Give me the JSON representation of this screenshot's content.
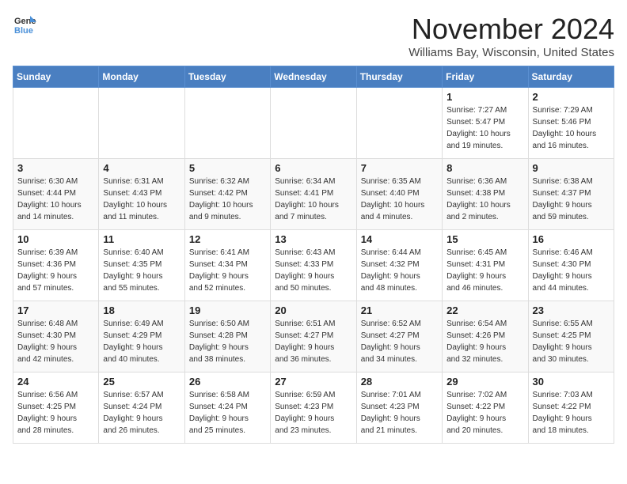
{
  "logo": {
    "line1": "General",
    "line2": "Blue"
  },
  "title": "November 2024",
  "location": "Williams Bay, Wisconsin, United States",
  "days_of_week": [
    "Sunday",
    "Monday",
    "Tuesday",
    "Wednesday",
    "Thursday",
    "Friday",
    "Saturday"
  ],
  "weeks": [
    [
      {
        "day": "",
        "info": ""
      },
      {
        "day": "",
        "info": ""
      },
      {
        "day": "",
        "info": ""
      },
      {
        "day": "",
        "info": ""
      },
      {
        "day": "",
        "info": ""
      },
      {
        "day": "1",
        "info": "Sunrise: 7:27 AM\nSunset: 5:47 PM\nDaylight: 10 hours\nand 19 minutes."
      },
      {
        "day": "2",
        "info": "Sunrise: 7:29 AM\nSunset: 5:46 PM\nDaylight: 10 hours\nand 16 minutes."
      }
    ],
    [
      {
        "day": "3",
        "info": "Sunrise: 6:30 AM\nSunset: 4:44 PM\nDaylight: 10 hours\nand 14 minutes."
      },
      {
        "day": "4",
        "info": "Sunrise: 6:31 AM\nSunset: 4:43 PM\nDaylight: 10 hours\nand 11 minutes."
      },
      {
        "day": "5",
        "info": "Sunrise: 6:32 AM\nSunset: 4:42 PM\nDaylight: 10 hours\nand 9 minutes."
      },
      {
        "day": "6",
        "info": "Sunrise: 6:34 AM\nSunset: 4:41 PM\nDaylight: 10 hours\nand 7 minutes."
      },
      {
        "day": "7",
        "info": "Sunrise: 6:35 AM\nSunset: 4:40 PM\nDaylight: 10 hours\nand 4 minutes."
      },
      {
        "day": "8",
        "info": "Sunrise: 6:36 AM\nSunset: 4:38 PM\nDaylight: 10 hours\nand 2 minutes."
      },
      {
        "day": "9",
        "info": "Sunrise: 6:38 AM\nSunset: 4:37 PM\nDaylight: 9 hours\nand 59 minutes."
      }
    ],
    [
      {
        "day": "10",
        "info": "Sunrise: 6:39 AM\nSunset: 4:36 PM\nDaylight: 9 hours\nand 57 minutes."
      },
      {
        "day": "11",
        "info": "Sunrise: 6:40 AM\nSunset: 4:35 PM\nDaylight: 9 hours\nand 55 minutes."
      },
      {
        "day": "12",
        "info": "Sunrise: 6:41 AM\nSunset: 4:34 PM\nDaylight: 9 hours\nand 52 minutes."
      },
      {
        "day": "13",
        "info": "Sunrise: 6:43 AM\nSunset: 4:33 PM\nDaylight: 9 hours\nand 50 minutes."
      },
      {
        "day": "14",
        "info": "Sunrise: 6:44 AM\nSunset: 4:32 PM\nDaylight: 9 hours\nand 48 minutes."
      },
      {
        "day": "15",
        "info": "Sunrise: 6:45 AM\nSunset: 4:31 PM\nDaylight: 9 hours\nand 46 minutes."
      },
      {
        "day": "16",
        "info": "Sunrise: 6:46 AM\nSunset: 4:30 PM\nDaylight: 9 hours\nand 44 minutes."
      }
    ],
    [
      {
        "day": "17",
        "info": "Sunrise: 6:48 AM\nSunset: 4:30 PM\nDaylight: 9 hours\nand 42 minutes."
      },
      {
        "day": "18",
        "info": "Sunrise: 6:49 AM\nSunset: 4:29 PM\nDaylight: 9 hours\nand 40 minutes."
      },
      {
        "day": "19",
        "info": "Sunrise: 6:50 AM\nSunset: 4:28 PM\nDaylight: 9 hours\nand 38 minutes."
      },
      {
        "day": "20",
        "info": "Sunrise: 6:51 AM\nSunset: 4:27 PM\nDaylight: 9 hours\nand 36 minutes."
      },
      {
        "day": "21",
        "info": "Sunrise: 6:52 AM\nSunset: 4:27 PM\nDaylight: 9 hours\nand 34 minutes."
      },
      {
        "day": "22",
        "info": "Sunrise: 6:54 AM\nSunset: 4:26 PM\nDaylight: 9 hours\nand 32 minutes."
      },
      {
        "day": "23",
        "info": "Sunrise: 6:55 AM\nSunset: 4:25 PM\nDaylight: 9 hours\nand 30 minutes."
      }
    ],
    [
      {
        "day": "24",
        "info": "Sunrise: 6:56 AM\nSunset: 4:25 PM\nDaylight: 9 hours\nand 28 minutes."
      },
      {
        "day": "25",
        "info": "Sunrise: 6:57 AM\nSunset: 4:24 PM\nDaylight: 9 hours\nand 26 minutes."
      },
      {
        "day": "26",
        "info": "Sunrise: 6:58 AM\nSunset: 4:24 PM\nDaylight: 9 hours\nand 25 minutes."
      },
      {
        "day": "27",
        "info": "Sunrise: 6:59 AM\nSunset: 4:23 PM\nDaylight: 9 hours\nand 23 minutes."
      },
      {
        "day": "28",
        "info": "Sunrise: 7:01 AM\nSunset: 4:23 PM\nDaylight: 9 hours\nand 21 minutes."
      },
      {
        "day": "29",
        "info": "Sunrise: 7:02 AM\nSunset: 4:22 PM\nDaylight: 9 hours\nand 20 minutes."
      },
      {
        "day": "30",
        "info": "Sunrise: 7:03 AM\nSunset: 4:22 PM\nDaylight: 9 hours\nand 18 minutes."
      }
    ]
  ]
}
